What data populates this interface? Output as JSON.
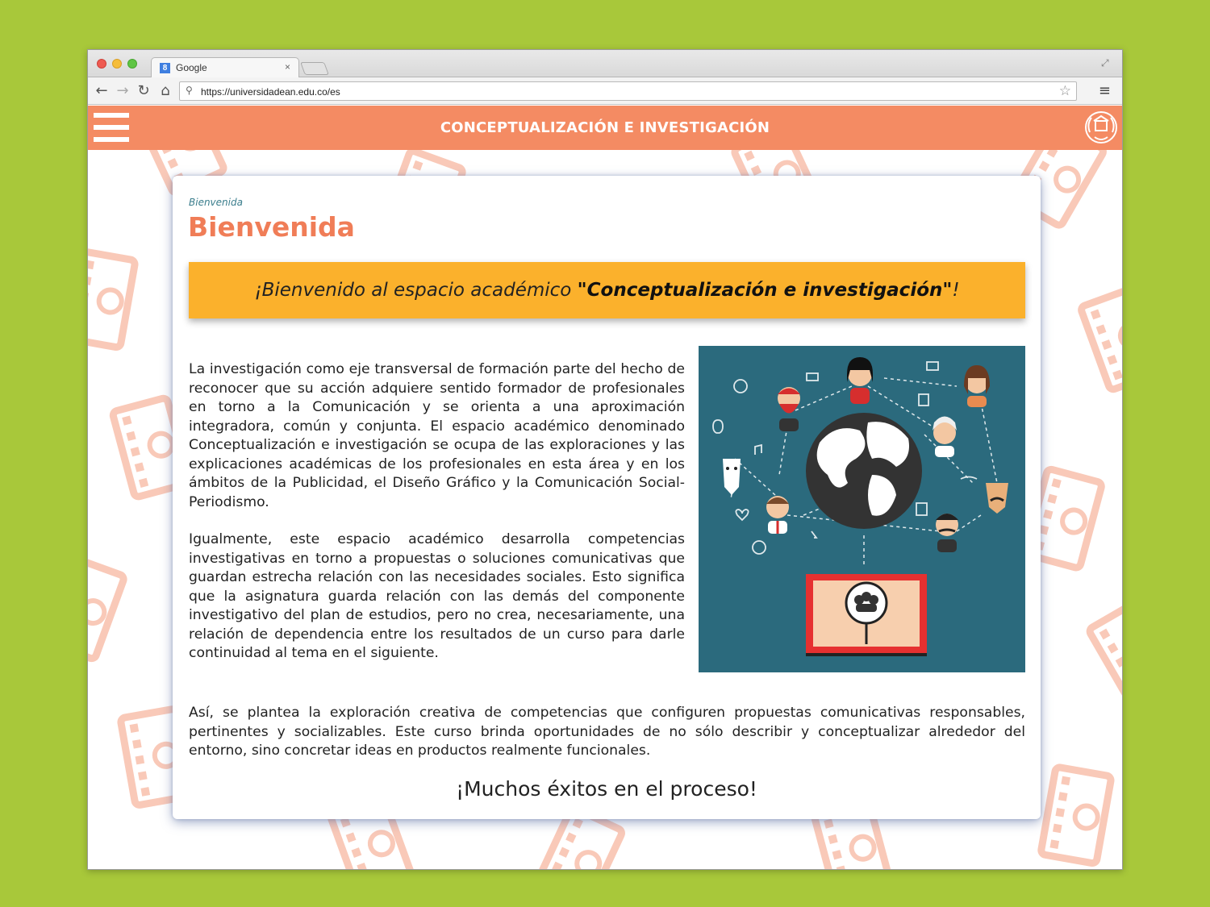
{
  "browser": {
    "tab_title": "Google",
    "tab_close": "×",
    "favicon_letter": "8",
    "url": "https://universidadean.edu.co/es"
  },
  "site": {
    "header_title": "CONCEPTUALIZACIÓN E INVESTIGACIÓN",
    "accent_color": "#f48b63",
    "banner_color": "#fbb12c"
  },
  "content": {
    "breadcrumb": "Bienvenida",
    "heading": "Bienvenida",
    "banner_prefix": "¡Bienvenido al espacio académico ",
    "banner_bold": "\"Conceptualización e investigación\"",
    "banner_suffix": "!",
    "paragraph_1": "La investigación como eje transversal de formación parte del hecho de reconocer que su acción adquiere sentido formador de profesionales en torno a la Comunicación y se orienta a una aproximación integradora, común y conjunta. El espacio académico denominado Conceptualización e investigación se ocupa de las exploraciones y las explicaciones académicas de los profesionales en esta área y en los ámbitos de la Publicidad, el Diseño Gráfico y la Comunicación Social-Periodismo.",
    "paragraph_2": "Igualmente, este espacio académico desarrolla competencias investigativas en torno a propuestas o soluciones comunicativas que guardan estrecha relación con las necesidades sociales. Esto significa que la asignatura guarda relación con las demás del componente investigativo del plan de estudios, pero no crea, necesariamente, una relación de dependencia entre los resultados de un curso para darle continuidad al tema en el siguiente.",
    "paragraph_3": "Así, se plantea la exploración creativa de competencias que configuren propuestas comunicativas responsables, pertinentes y socializables. Este curso brinda oportunidades de no sólo describir y conceptualizar alrededor del entorno, sino concretar ideas en productos realmente funcionales.",
    "closing": "¡Muchos éxitos en el proceso!"
  }
}
